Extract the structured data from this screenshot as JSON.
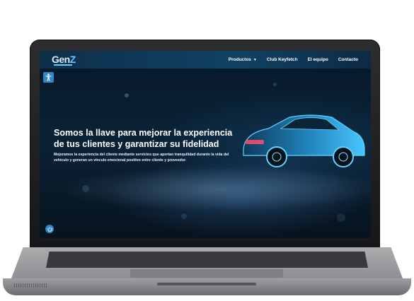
{
  "brand": {
    "logo_main": "Gen",
    "logo_accent": "Z"
  },
  "nav": {
    "items": [
      {
        "label": "Productos",
        "has_dropdown": true
      },
      {
        "label": "Club Keyfetch",
        "has_dropdown": false
      },
      {
        "label": "El equipo",
        "has_dropdown": false
      },
      {
        "label": "Contacto",
        "has_dropdown": false
      }
    ],
    "caret": "▼"
  },
  "hero": {
    "title": "Somos la llave para mejorar la experiencia de tus clientes y garantizar su fidelidad",
    "subtitle": "Mejoramos la experiencia del cliente mediante servicios que aportan tranquilidad durante la vida del vehículo y generan un vínculo emocional positivo entre cliente y proveedor."
  },
  "icons": {
    "accessibility": "accessibility-icon",
    "round_button": "power-icon"
  },
  "colors": {
    "nav_bg": "#114264",
    "accent": "#2f87c7",
    "hero_bg": "#07111c",
    "logo_accent": "#6cc6ff",
    "car_glow": "#45c8ff"
  }
}
